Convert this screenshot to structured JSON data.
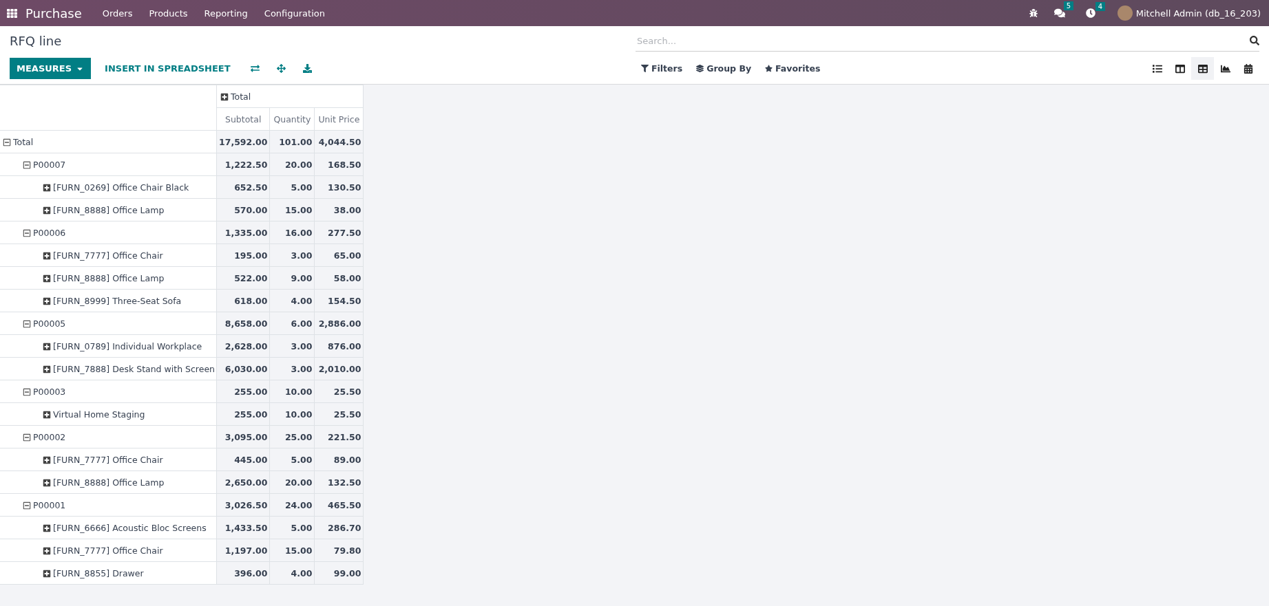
{
  "navbar": {
    "app": "Purchase",
    "menu": [
      "Orders",
      "Products",
      "Reporting",
      "Configuration"
    ],
    "messages_badge": "5",
    "activities_badge": "4",
    "user": "Mitchell Admin (db_16_203)"
  },
  "control_panel": {
    "title": "RFQ line",
    "measures_button": "MEASURES",
    "insert_button": "INSERT IN SPREADSHEET",
    "search": {
      "placeholder": "Search..."
    },
    "filters": [
      "Filters",
      "Group By",
      "Favorites"
    ],
    "views": [
      {
        "kind": "list",
        "selected": false
      },
      {
        "kind": "kanban",
        "selected": false
      },
      {
        "kind": "pivot",
        "selected": true
      },
      {
        "kind": "graph",
        "selected": false
      },
      {
        "kind": "calendar",
        "selected": false
      }
    ]
  },
  "pivot": {
    "column_header": {
      "label": "Total",
      "expanded": false
    },
    "measures": [
      "Subtotal",
      "Quantity",
      "Unit Price"
    ],
    "rows": [
      {
        "label": "Total",
        "expanded": true,
        "values": [
          "17,592.00",
          "101.00",
          "4,044.50"
        ],
        "children": [
          {
            "label": "P00007",
            "expanded": true,
            "values": [
              "1,222.50",
              "20.00",
              "168.50"
            ],
            "children": [
              {
                "label": "[FURN_0269] Office Chair Black",
                "expanded": false,
                "values": [
                  "652.50",
                  "5.00",
                  "130.50"
                ]
              },
              {
                "label": "[FURN_8888] Office Lamp",
                "expanded": false,
                "values": [
                  "570.00",
                  "15.00",
                  "38.00"
                ]
              }
            ]
          },
          {
            "label": "P00006",
            "expanded": true,
            "values": [
              "1,335.00",
              "16.00",
              "277.50"
            ],
            "children": [
              {
                "label": "[FURN_7777] Office Chair",
                "expanded": false,
                "values": [
                  "195.00",
                  "3.00",
                  "65.00"
                ]
              },
              {
                "label": "[FURN_8888] Office Lamp",
                "expanded": false,
                "values": [
                  "522.00",
                  "9.00",
                  "58.00"
                ]
              },
              {
                "label": "[FURN_8999] Three-Seat Sofa",
                "expanded": false,
                "values": [
                  "618.00",
                  "4.00",
                  "154.50"
                ]
              }
            ]
          },
          {
            "label": "P00005",
            "expanded": true,
            "values": [
              "8,658.00",
              "6.00",
              "2,886.00"
            ],
            "children": [
              {
                "label": "[FURN_0789] Individual Workplace",
                "expanded": false,
                "values": [
                  "2,628.00",
                  "3.00",
                  "876.00"
                ]
              },
              {
                "label": "[FURN_7888] Desk Stand with Screen",
                "expanded": false,
                "values": [
                  "6,030.00",
                  "3.00",
                  "2,010.00"
                ]
              }
            ]
          },
          {
            "label": "P00003",
            "expanded": true,
            "values": [
              "255.00",
              "10.00",
              "25.50"
            ],
            "children": [
              {
                "label": "Virtual Home Staging",
                "expanded": false,
                "values": [
                  "255.00",
                  "10.00",
                  "25.50"
                ]
              }
            ]
          },
          {
            "label": "P00002",
            "expanded": true,
            "values": [
              "3,095.00",
              "25.00",
              "221.50"
            ],
            "children": [
              {
                "label": "[FURN_7777] Office Chair",
                "expanded": false,
                "values": [
                  "445.00",
                  "5.00",
                  "89.00"
                ]
              },
              {
                "label": "[FURN_8888] Office Lamp",
                "expanded": false,
                "values": [
                  "2,650.00",
                  "20.00",
                  "132.50"
                ]
              }
            ]
          },
          {
            "label": "P00001",
            "expanded": true,
            "values": [
              "3,026.50",
              "24.00",
              "465.50"
            ],
            "children": [
              {
                "label": "[FURN_6666] Acoustic Bloc Screens",
                "expanded": false,
                "values": [
                  "1,433.50",
                  "5.00",
                  "286.70"
                ]
              },
              {
                "label": "[FURN_7777] Office Chair",
                "expanded": false,
                "values": [
                  "1,197.00",
                  "15.00",
                  "79.80"
                ]
              },
              {
                "label": "[FURN_8855] Drawer",
                "expanded": false,
                "values": [
                  "396.00",
                  "4.00",
                  "99.00"
                ]
              }
            ]
          }
        ]
      }
    ]
  }
}
